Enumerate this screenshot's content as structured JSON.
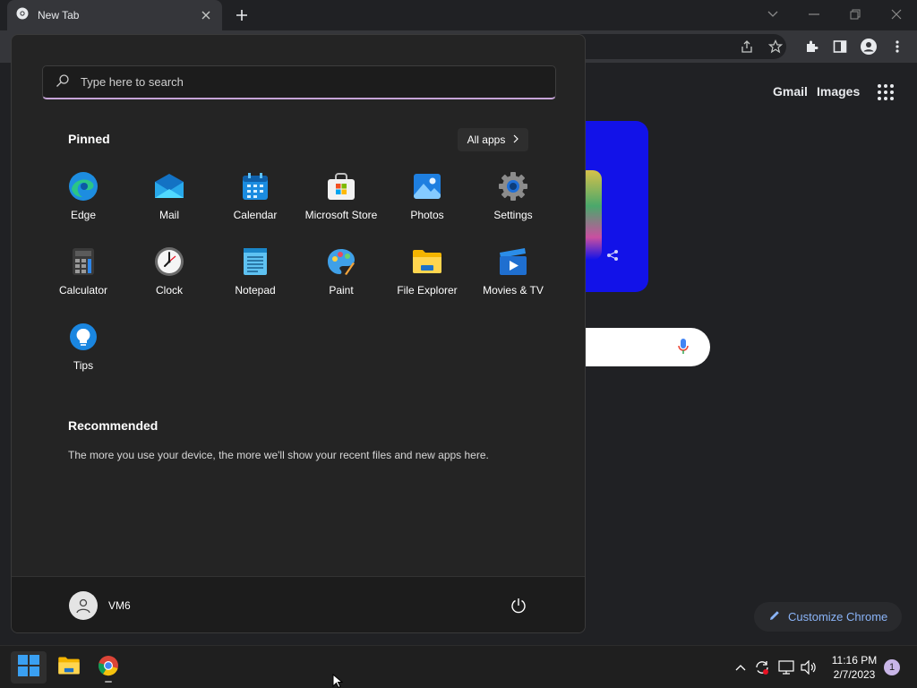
{
  "browser": {
    "tab_title": "New Tab",
    "ntp_links": {
      "gmail": "Gmail",
      "images": "Images"
    },
    "customize_label": "Customize Chrome"
  },
  "start_menu": {
    "search_placeholder": "Type here to search",
    "pinned_title": "Pinned",
    "all_apps_label": "All apps",
    "pinned": [
      {
        "label": "Edge",
        "icon": "edge-icon"
      },
      {
        "label": "Mail",
        "icon": "mail-icon"
      },
      {
        "label": "Calendar",
        "icon": "calendar-icon"
      },
      {
        "label": "Microsoft Store",
        "icon": "store-icon"
      },
      {
        "label": "Photos",
        "icon": "photos-icon"
      },
      {
        "label": "Settings",
        "icon": "settings-icon"
      },
      {
        "label": "Calculator",
        "icon": "calculator-icon"
      },
      {
        "label": "Clock",
        "icon": "clock-icon"
      },
      {
        "label": "Notepad",
        "icon": "notepad-icon"
      },
      {
        "label": "Paint",
        "icon": "paint-icon"
      },
      {
        "label": "File Explorer",
        "icon": "file-explorer-icon"
      },
      {
        "label": "Movies & TV",
        "icon": "movies-tv-icon"
      },
      {
        "label": "Tips",
        "icon": "tips-icon"
      }
    ],
    "recommended_title": "Recommended",
    "recommended_text": "The more you use your device, the more we'll show your recent files and new apps here.",
    "user_name": "VM6"
  },
  "taskbar": {
    "time": "11:16 PM",
    "date": "2/7/2023",
    "notification_count": "1"
  },
  "colors": {
    "accent": "#c6a4d8",
    "start_bg": "#242424",
    "taskbar_bg": "#1f1f1f",
    "chrome_bg": "#202124",
    "link_blue": "#8ab4f8"
  }
}
